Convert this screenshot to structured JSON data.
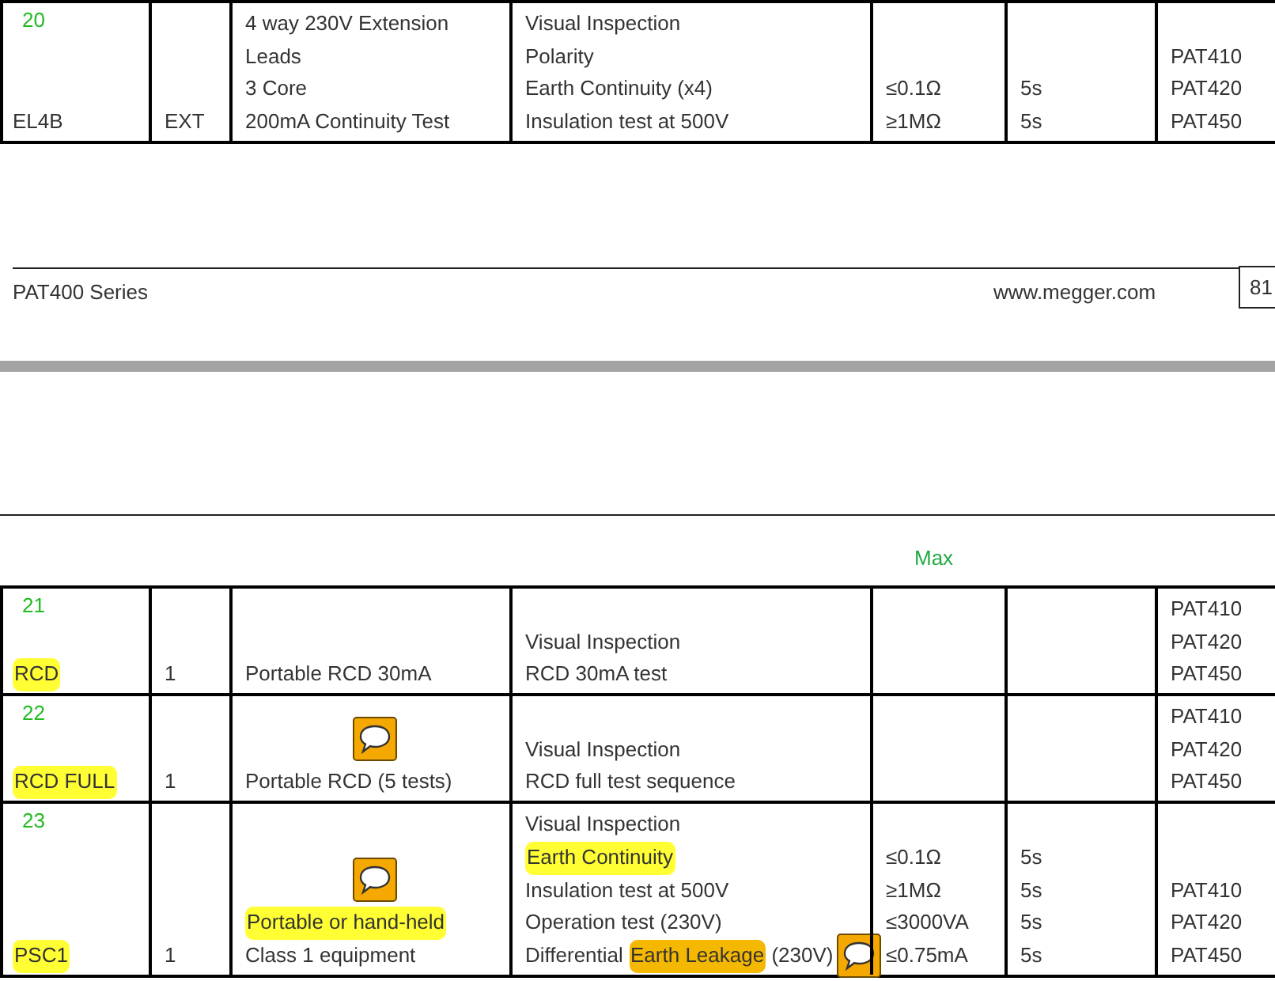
{
  "pages": [
    {
      "table": {
        "rows": [
          {
            "number": "20",
            "cells": [
              [
                [
                  {
                    "kind": "text",
                    "text": "EL4B"
                  }
                ]
              ],
              [
                [
                  {
                    "kind": "text",
                    "text": "EXT"
                  }
                ]
              ],
              [
                [
                  {
                    "kind": "text",
                    "text": "4 way 230V Extension"
                  }
                ],
                [
                  {
                    "kind": "text",
                    "text": "Leads"
                  }
                ],
                [
                  {
                    "kind": "text",
                    "text": "3 Core"
                  }
                ],
                [
                  {
                    "kind": "text",
                    "text": "200mA Continuity Test"
                  }
                ]
              ],
              [
                [
                  {
                    "kind": "text",
                    "text": "Visual Inspection"
                  }
                ],
                [
                  {
                    "kind": "text",
                    "text": "Polarity"
                  }
                ],
                [
                  {
                    "kind": "text",
                    "text": "Earth Continuity (x4)"
                  }
                ],
                [
                  {
                    "kind": "text",
                    "text": "Insulation test at 500V"
                  }
                ]
              ],
              [
                [
                  {
                    "kind": "text",
                    "text": "≤0.1Ω"
                  }
                ],
                [
                  {
                    "kind": "text",
                    "text": "≥1MΩ"
                  }
                ]
              ],
              [
                [
                  {
                    "kind": "text",
                    "text": "5s"
                  }
                ],
                [
                  {
                    "kind": "text",
                    "text": "5s"
                  }
                ]
              ],
              [
                [
                  {
                    "kind": "text",
                    "text": "PAT410"
                  }
                ],
                [
                  {
                    "kind": "text",
                    "text": "PAT420"
                  }
                ],
                [
                  {
                    "kind": "text",
                    "text": "PAT450"
                  }
                ]
              ]
            ]
          }
        ]
      },
      "footer": {
        "series": "PAT400 Series",
        "website": "www.megger.com",
        "page_number": "81"
      }
    },
    {
      "header": {
        "column_5": "Max"
      },
      "table": {
        "rows": [
          {
            "number": "21",
            "cells": [
              [
                [
                  {
                    "kind": "text",
                    "text": "RCD",
                    "color": "#ffff33"
                  }
                ]
              ],
              [
                [
                  {
                    "kind": "text",
                    "text": "1"
                  }
                ]
              ],
              [
                [
                  {
                    "kind": "text",
                    "text": "Portable RCD 30mA"
                  }
                ]
              ],
              [
                [
                  {
                    "kind": "text",
                    "text": "Visual Inspection"
                  }
                ],
                [
                  {
                    "kind": "text",
                    "text": "RCD 30mA test"
                  }
                ]
              ],
              [],
              [],
              [
                [
                  {
                    "kind": "text",
                    "text": "PAT410"
                  }
                ],
                [
                  {
                    "kind": "text",
                    "text": "PAT420"
                  }
                ],
                [
                  {
                    "kind": "text",
                    "text": "PAT450"
                  }
                ]
              ]
            ]
          },
          {
            "number": "22",
            "cells": [
              [
                [
                  {
                    "kind": "text",
                    "text": "RCD FULL",
                    "color": "#ffff33"
                  }
                ]
              ],
              [
                [
                  {
                    "kind": "text",
                    "text": "1"
                  }
                ]
              ],
              [
                [
                  {
                    "kind": "note"
                  }
                ],
                [
                  {
                    "kind": "text",
                    "text": "Portable RCD (5 tests)"
                  }
                ]
              ],
              [
                [
                  {
                    "kind": "text",
                    "text": "Visual Inspection"
                  }
                ],
                [
                  {
                    "kind": "text",
                    "text": "RCD full test sequence"
                  }
                ]
              ],
              [],
              [],
              [
                [
                  {
                    "kind": "text",
                    "text": "PAT410"
                  }
                ],
                [
                  {
                    "kind": "text",
                    "text": "PAT420"
                  }
                ],
                [
                  {
                    "kind": "text",
                    "text": "PAT450"
                  }
                ]
              ]
            ]
          },
          {
            "number": "23",
            "cells": [
              [
                [
                  {
                    "kind": "text",
                    "text": "PSC1",
                    "color": "#ffff33"
                  }
                ]
              ],
              [
                [
                  {
                    "kind": "text",
                    "text": "1"
                  }
                ]
              ],
              [
                [
                  {
                    "kind": "note"
                  }
                ],
                [
                  {
                    "kind": "text",
                    "text": "Portable or hand-held",
                    "color": "#ffff33"
                  }
                ],
                [
                  {
                    "kind": "text",
                    "text": "Class 1 equipment"
                  }
                ]
              ],
              [
                [
                  {
                    "kind": "text",
                    "text": "Visual Inspection"
                  }
                ],
                [
                  {
                    "kind": "text",
                    "text": "Earth Continuity",
                    "color": "#ffff33"
                  }
                ],
                [
                  {
                    "kind": "text",
                    "text": "Insulation test at 500V"
                  }
                ],
                [
                  {
                    "kind": "text",
                    "text": "Operation test (230V)"
                  }
                ],
                [
                  {
                    "kind": "text",
                    "text": "Differential "
                  },
                  {
                    "kind": "text",
                    "text": "Earth Leakage",
                    "color": "#f5b800"
                  },
                  {
                    "kind": "text",
                    "text": " (230V)"
                  },
                  {
                    "kind": "note"
                  }
                ]
              ],
              [
                [
                  {
                    "kind": "text",
                    "text": "≤0.1Ω"
                  }
                ],
                [
                  {
                    "kind": "text",
                    "text": "≥1MΩ"
                  }
                ],
                [
                  {
                    "kind": "text",
                    "text": "≤3000VA"
                  }
                ],
                [
                  {
                    "kind": "text",
                    "text": "≤0.75mA"
                  }
                ]
              ],
              [
                [
                  {
                    "kind": "text",
                    "text": "5s"
                  }
                ],
                [
                  {
                    "kind": "text",
                    "text": "5s"
                  }
                ],
                [
                  {
                    "kind": "text",
                    "text": "5s"
                  }
                ],
                [
                  {
                    "kind": "text",
                    "text": "5s"
                  }
                ]
              ],
              [
                [
                  {
                    "kind": "text",
                    "text": "PAT410"
                  }
                ],
                [
                  {
                    "kind": "text",
                    "text": "PAT420"
                  }
                ],
                [
                  {
                    "kind": "text",
                    "text": "PAT450"
                  }
                ]
              ]
            ]
          }
        ]
      }
    }
  ]
}
